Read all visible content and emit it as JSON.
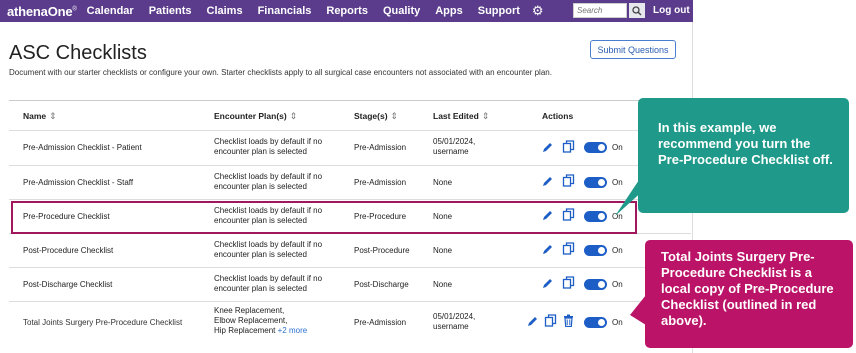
{
  "nav": {
    "logo": "athenaOne",
    "logo_mark": "®",
    "items": [
      "Calendar",
      "Patients",
      "Claims",
      "Financials",
      "Reports",
      "Quality",
      "Apps",
      "Support"
    ],
    "search_placeholder": "Search",
    "logout": "Log out"
  },
  "page": {
    "title": "ASC Checklists",
    "description": "Document with our starter checklists or configure your own. Starter checklists apply to all surgical case encounters not associated with an encounter plan.",
    "submit_button": "Submit Questions"
  },
  "table": {
    "headers": {
      "name": "Name",
      "plan": "Encounter Plan(s)",
      "stage": "Stage(s)",
      "edited": "Last Edited",
      "actions": "Actions"
    },
    "rows": [
      {
        "name": "Pre-Admission Checklist - Patient",
        "plan_1": "Checklist loads by default if no",
        "plan_2": "encounter plan is selected",
        "stage": "Pre-Admission",
        "edited_1": "05/01/2024,",
        "edited_2": "username",
        "toggle": "On"
      },
      {
        "name": "Pre-Admission Checklist - Staff",
        "plan_1": "Checklist loads by default if no",
        "plan_2": "encounter plan is selected",
        "stage": "Pre-Admission",
        "edited_1": "None",
        "edited_2": "",
        "toggle": "On"
      },
      {
        "name": "Pre-Procedure Checklist",
        "plan_1": "Checklist loads by default if no",
        "plan_2": "encounter plan is selected",
        "stage": "Pre-Procedure",
        "edited_1": "None",
        "edited_2": "",
        "toggle": "On"
      },
      {
        "name": "Post-Procedure Checklist",
        "plan_1": "Checklist loads by default if no",
        "plan_2": "encounter plan is selected",
        "stage": "Post-Procedure",
        "edited_1": "None",
        "edited_2": "",
        "toggle": "On"
      },
      {
        "name": "Post-Discharge Checklist",
        "plan_1": "Checklist loads by default if no",
        "plan_2": "encounter plan is selected",
        "stage": "Post-Discharge",
        "edited_1": "None",
        "edited_2": "",
        "toggle": "On"
      },
      {
        "name": "Total Joints Surgery Pre-Procedure Checklist",
        "plan_1": "Knee Replacement,",
        "plan_2": "Elbow Replacement,",
        "plan_3": "Hip Replacement",
        "plan_more": "+2 more",
        "stage": "Pre-Admission",
        "edited_1": "05/01/2024,",
        "edited_2": "username",
        "toggle": "On"
      }
    ]
  },
  "callouts": {
    "teal": "In this example, we recommend you turn the Pre-Procedure Checklist off.",
    "red": "Total Joints Surgery Pre-Procedure Checklist is a local copy of Pre-Procedure Checklist (outlined in red above)."
  },
  "colors": {
    "nav_bg": "#5b3c8c",
    "accent_blue": "#1d5ec6",
    "teal_callout": "#1f9a8a",
    "red_callout": "#bb1367",
    "highlight_border": "#a0175e"
  },
  "icons": [
    "gear-icon",
    "search-icon",
    "sort-icon",
    "pencil-icon",
    "copy-icon",
    "trash-icon",
    "toggle-switch"
  ]
}
